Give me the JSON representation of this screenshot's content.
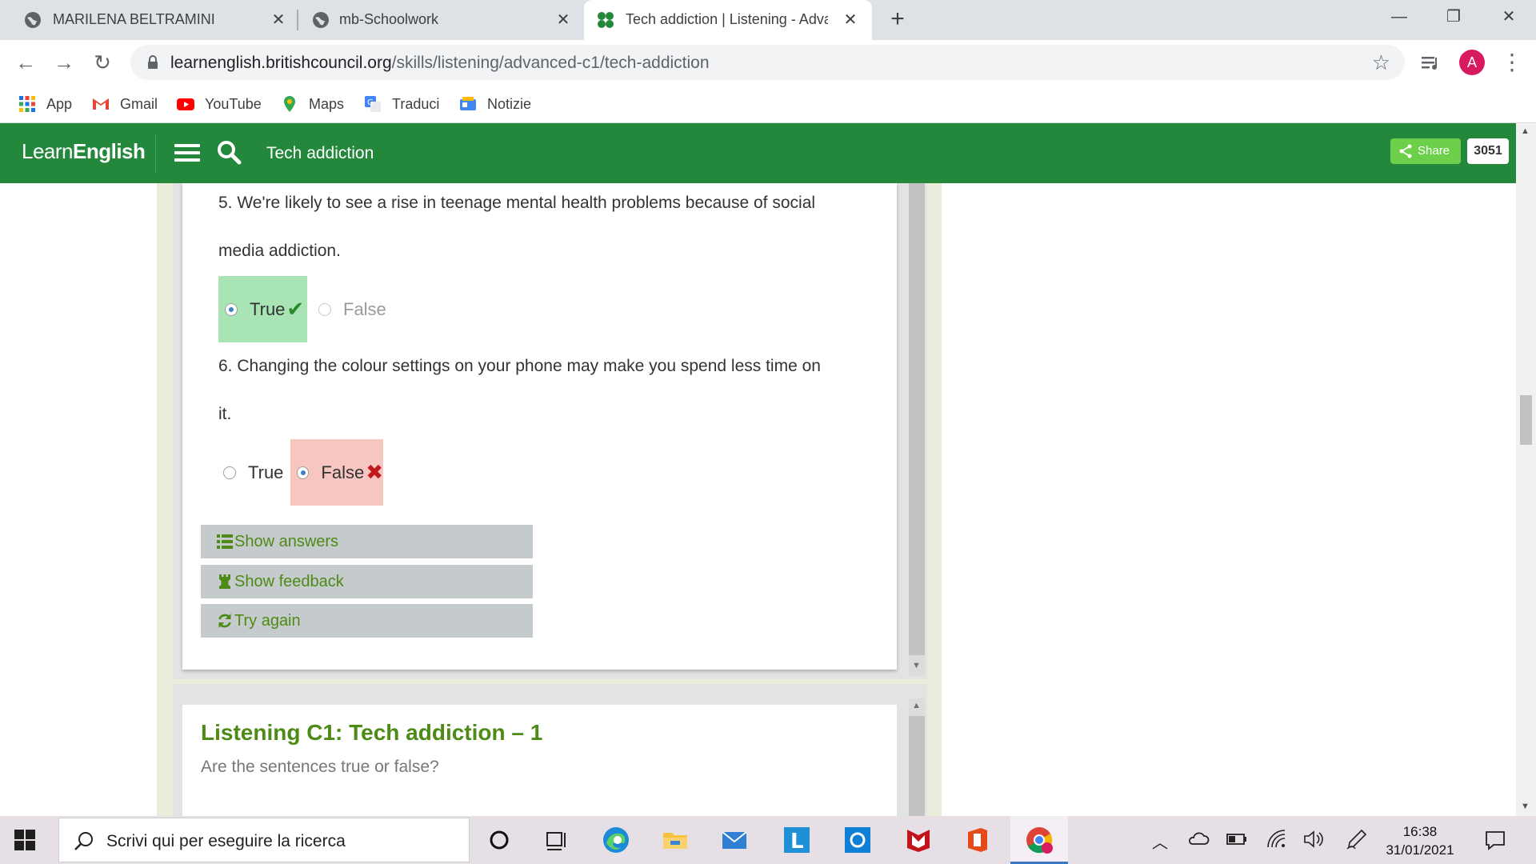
{
  "browser": {
    "tabs": [
      {
        "title": "MARILENA BELTRAMINI",
        "active": false
      },
      {
        "title": "mb-Schoolwork",
        "active": false
      },
      {
        "title": "Tech addiction | Listening - Advan",
        "active": true
      }
    ],
    "url_host": "learnenglish.britishcouncil.org",
    "url_path": "/skills/listening/advanced-c1/tech-addiction",
    "profile_initial": "A",
    "bookmarks": [
      "App",
      "Gmail",
      "YouTube",
      "Maps",
      "Traduci",
      "Notizie"
    ]
  },
  "site": {
    "logo_light": "Learn",
    "logo_bold": "English",
    "page_title": "Tech addiction",
    "share_label": "Share",
    "share_count": "3051"
  },
  "quiz": {
    "questions": [
      {
        "line1": "5. We're likely to see a rise in teenage mental health problems because of social",
        "line2": "media addiction.",
        "options": [
          {
            "label": "True",
            "selected": true,
            "state": "correct"
          },
          {
            "label": "False",
            "selected": false,
            "state": "dim"
          }
        ]
      },
      {
        "line1": "6. Changing the colour settings on your phone may make you spend less time on",
        "line2": "it.",
        "options": [
          {
            "label": "True",
            "selected": false,
            "state": "normal"
          },
          {
            "label": "False",
            "selected": true,
            "state": "wrong"
          }
        ]
      }
    ],
    "buttons": {
      "show_answers": "Show answers",
      "show_feedback": "Show feedback",
      "try_again": "Try again"
    }
  },
  "next_section": {
    "title": "Listening C1: Tech addiction – 1",
    "subtitle": "Are the sentences true or false?"
  },
  "taskbar": {
    "search_placeholder": "Scrivi qui per eseguire la ricerca",
    "time": "16:38",
    "date": "31/01/2021"
  },
  "colors": {
    "site_green": "#23883c",
    "correct_bg": "#a9e5b4",
    "wrong_bg": "#f7c6c1",
    "action_text": "#4d8a16"
  }
}
